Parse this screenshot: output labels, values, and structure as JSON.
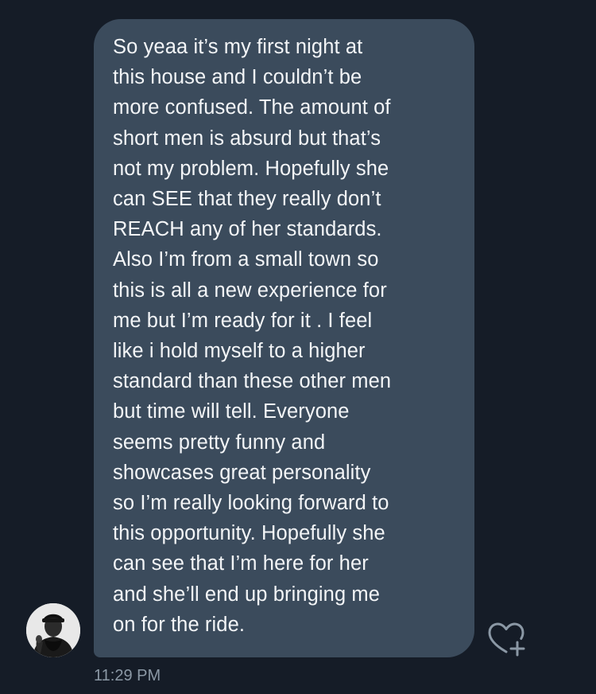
{
  "conversation": {
    "message": {
      "text": "So yeaa it’s my first night at\nthis house and I couldn’t be\nmore confused. The amount of\nshort men is absurd but that’s\nnot my problem. Hopefully she\ncan SEE that they really don’t\nREACH any of her standards.\nAlso I’m from a small town so\nthis is all a new experience for\nme but I’m ready for it . I feel\nlike i hold myself to a higher\nstandard than these other men\nbut time will tell. Everyone\nseems pretty funny and\nshowcases great personality\nso I’m really looking forward to\nthis opportunity. Hopefully she\ncan see that I’m here for her\nand she’ll end up bringing me\non for the ride.",
      "timestamp": "11:29 PM",
      "sender_avatar": "user-avatar-photo",
      "reaction_icon": "heart-plus-icon"
    }
  },
  "colors": {
    "background": "#151c27",
    "bubble": "#3b4b5c",
    "message_text": "#f3f5f7",
    "timestamp": "#8b98a5",
    "icon": "#8b98a5"
  }
}
